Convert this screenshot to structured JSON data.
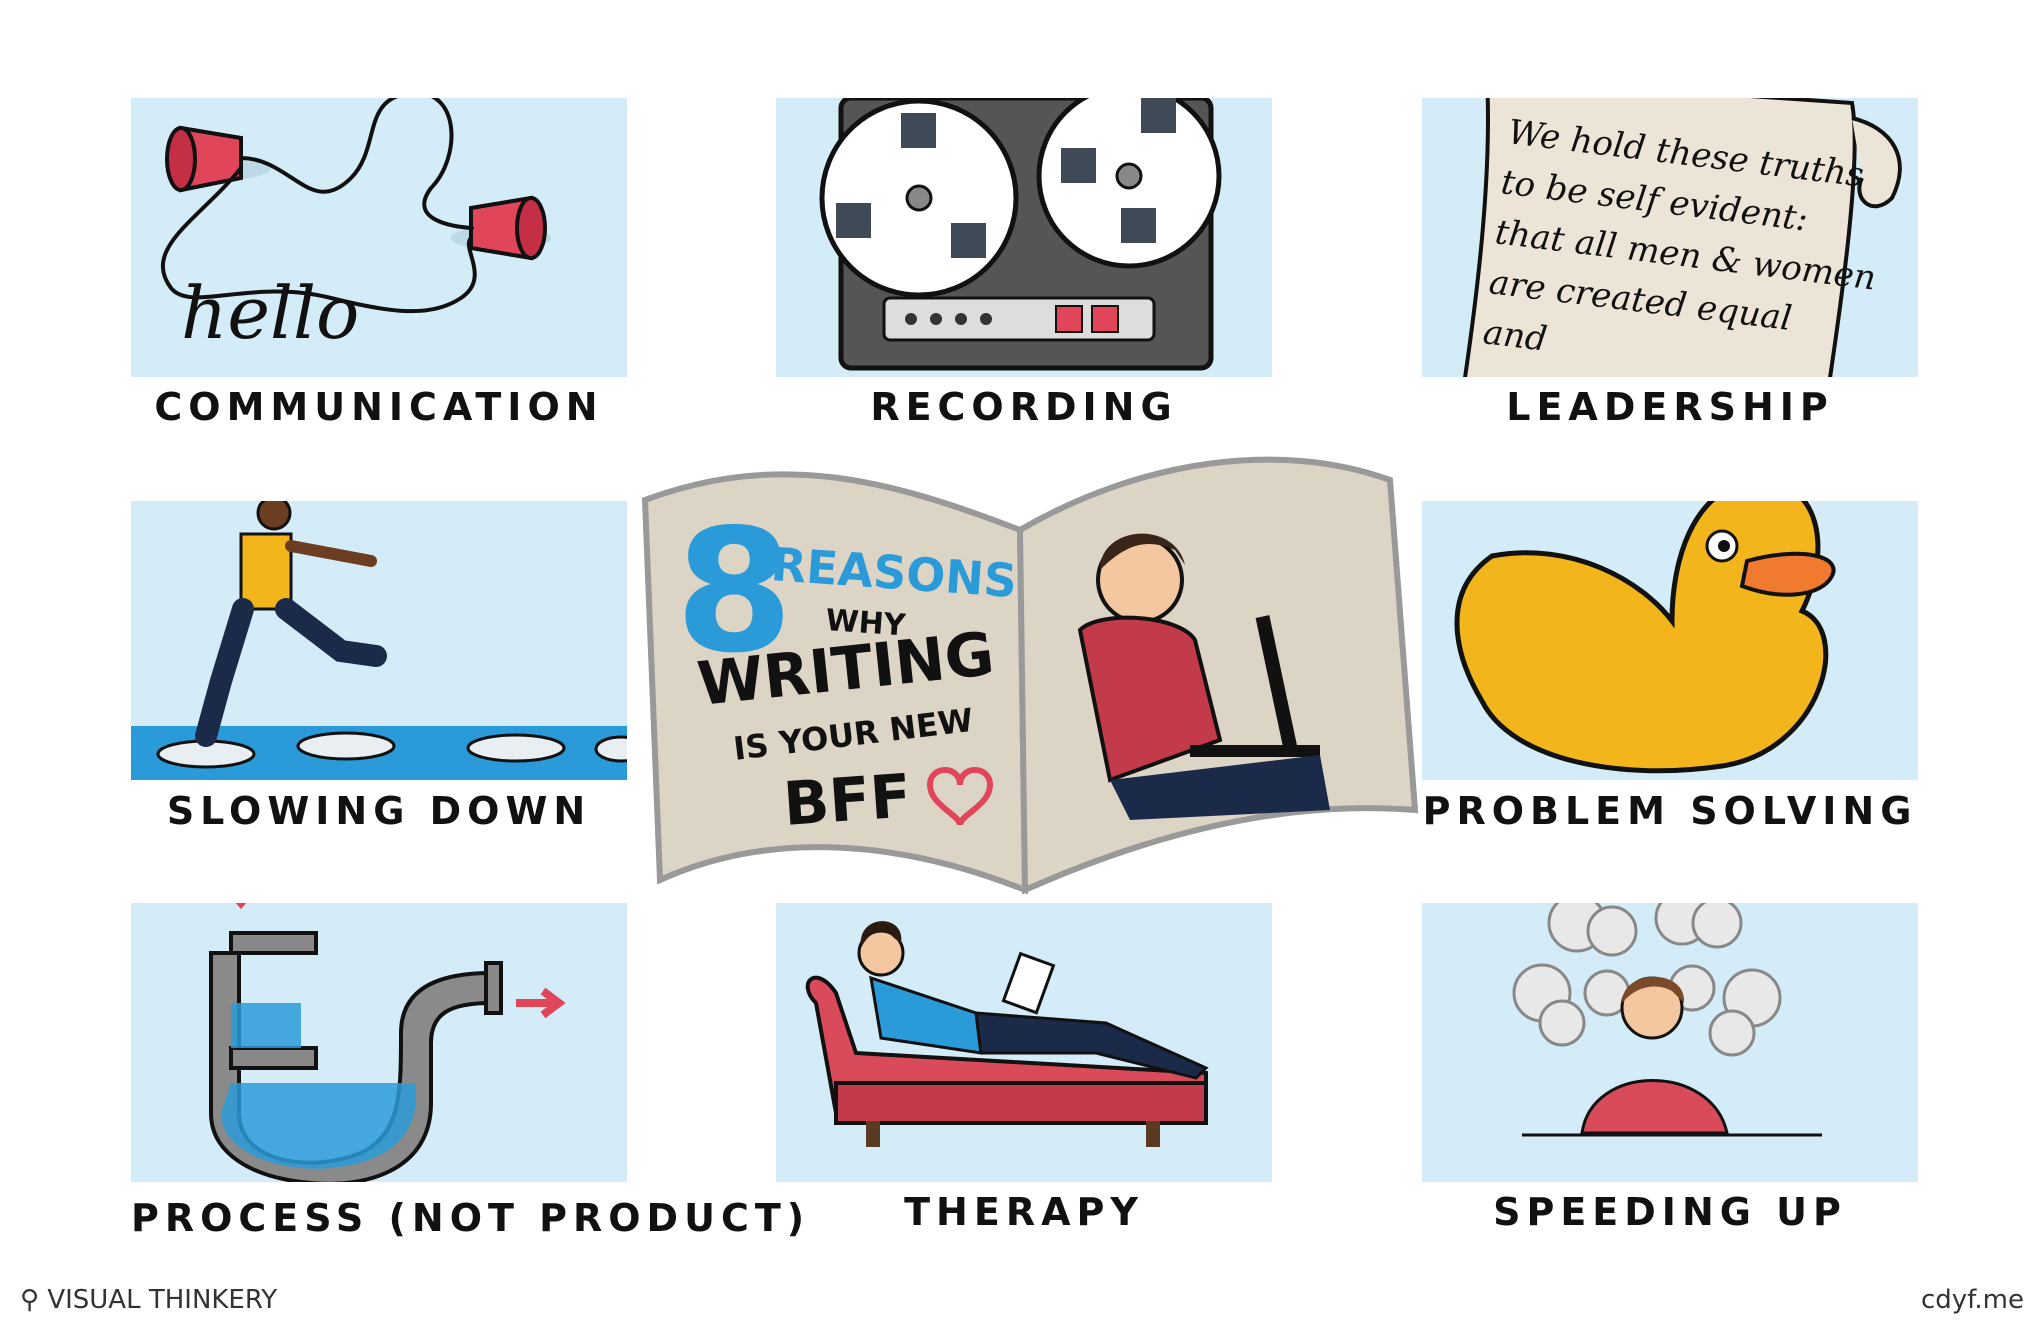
{
  "panels": {
    "communication": "COMMUNICATION",
    "recording": "RECORDING",
    "leadership": "LEADERSHIP",
    "slowing_down": "SLOWING  DOWN",
    "problem_solving": "PROBLEM  SOLVING",
    "process": "PROCESS (NOT PRODUCT)",
    "therapy": "THERAPY",
    "speeding_up": "SPEEDING  UP"
  },
  "hello_text": "hello",
  "scroll_lines": [
    "We hold these truths",
    "to be self evident:",
    "that all men & women",
    "are created equal",
    "and"
  ],
  "book": {
    "number": "8",
    "reasons": "REASONS",
    "why": "WHY",
    "writing": "WRITING",
    "is_your_new": "IS YOUR NEW",
    "bff": "BFF"
  },
  "footer": {
    "left": "VISUAL THINKERY",
    "right": "cdyf.me"
  },
  "colors": {
    "panel_bg": "#d3ecf7",
    "accent_red": "#e0455a",
    "accent_blue": "#2a9bd8",
    "duck_yellow": "#f3b51c"
  }
}
